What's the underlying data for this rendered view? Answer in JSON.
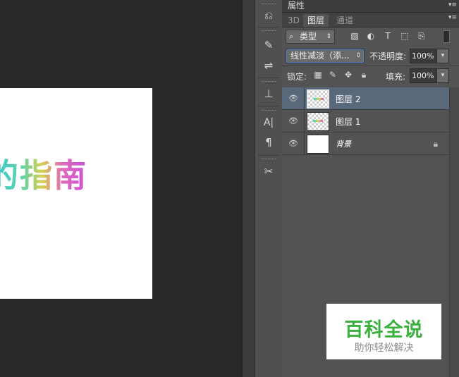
{
  "canvas": {
    "text": "的指南"
  },
  "tools": [
    {
      "name": "history-icon",
      "glyph": "⎌"
    },
    {
      "name": "brush-preset-icon",
      "glyph": "✎"
    },
    {
      "name": "adjustments-icon",
      "glyph": "⇌"
    },
    {
      "name": "clone-source-icon",
      "glyph": "⊥"
    },
    {
      "name": "character-icon",
      "glyph": "A|"
    },
    {
      "name": "paragraph-icon",
      "glyph": "¶"
    },
    {
      "name": "tool-presets-icon",
      "glyph": "✂"
    }
  ],
  "properties_panel": {
    "tab_label": "属性"
  },
  "layers_panel": {
    "tabs": [
      {
        "label": "3D",
        "active": false
      },
      {
        "label": "图层",
        "active": true
      },
      {
        "label": "通道",
        "active": false
      }
    ],
    "filter": {
      "kind_label": "类型"
    },
    "blend_mode": "线性减淡（添...",
    "opacity_label": "不透明度:",
    "opacity_value": "100%",
    "lock_label": "锁定:",
    "fill_label": "填充:",
    "fill_value": "100%",
    "layers": [
      {
        "name": "图层 2",
        "selected": true,
        "visible": true,
        "locked": false,
        "thumb": "transparent"
      },
      {
        "name": "图层 1",
        "selected": false,
        "visible": true,
        "locked": false,
        "thumb": "transparent"
      },
      {
        "name": "背景",
        "selected": false,
        "visible": true,
        "locked": true,
        "thumb": "white"
      }
    ]
  },
  "watermark": {
    "title": "百科全说",
    "subtitle": "助你轻松解决"
  }
}
